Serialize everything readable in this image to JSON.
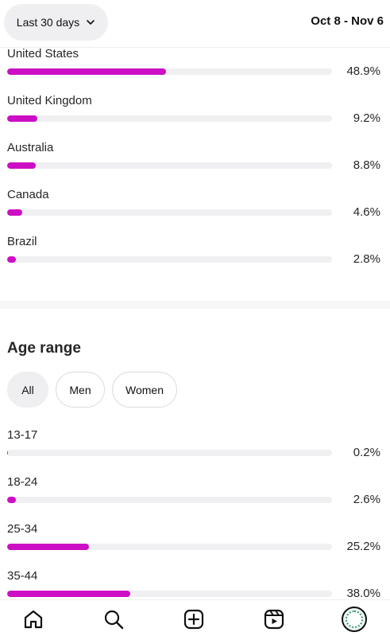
{
  "header": {
    "range_label": "Last 30 days",
    "date_range": "Oct 8 - Nov 6"
  },
  "countries": [
    {
      "label": "United States",
      "percent": 48.9,
      "value_text": "48.9%"
    },
    {
      "label": "United Kingdom",
      "percent": 9.2,
      "value_text": "9.2%"
    },
    {
      "label": "Australia",
      "percent": 8.8,
      "value_text": "8.8%"
    },
    {
      "label": "Canada",
      "percent": 4.6,
      "value_text": "4.6%"
    },
    {
      "label": "Brazil",
      "percent": 2.8,
      "value_text": "2.8%"
    }
  ],
  "age_range": {
    "title": "Age range",
    "filters": [
      "All",
      "Men",
      "Women"
    ],
    "selected_filter": "All",
    "rows": [
      {
        "label": "13-17",
        "percent": 0.2,
        "value_text": "0.2%"
      },
      {
        "label": "18-24",
        "percent": 2.6,
        "value_text": "2.6%"
      },
      {
        "label": "25-34",
        "percent": 25.2,
        "value_text": "25.2%"
      },
      {
        "label": "35-44",
        "percent": 38.0,
        "value_text": "38.0%"
      }
    ]
  },
  "colors": {
    "bar_fill": "#cc0ec4",
    "bar_track": "#f0f0f2"
  },
  "bottom_nav": {
    "icons": [
      "home-icon",
      "search-icon",
      "create-icon",
      "reels-icon",
      "profile-avatar"
    ]
  }
}
